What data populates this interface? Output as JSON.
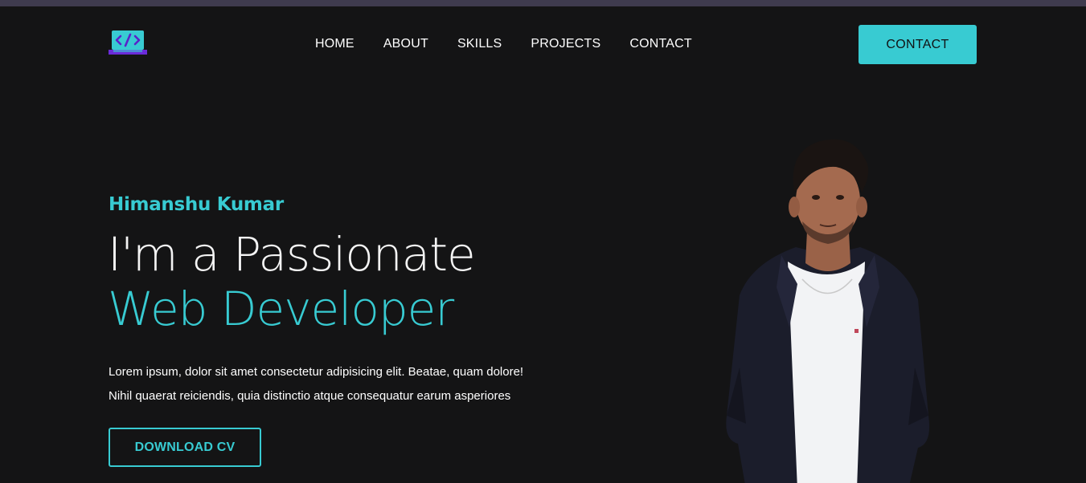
{
  "nav": {
    "logo_icon": "code-laptop-icon",
    "items": [
      "HOME",
      "ABOUT",
      "SKILLS",
      "PROJECTS",
      "CONTACT"
    ],
    "contact_button": "CONTACT"
  },
  "hero": {
    "name": "Himanshu Kumar",
    "headline_line1": "I'm a Passionate",
    "headline_line2": "Web Developer",
    "description_line1": "Lorem ipsum, dolor sit amet consectetur adipisicing elit. Beatae, quam dolore!",
    "description_line2": "Nihil quaerat reiciendis, quia distinctio atque consequatur earum asperiores",
    "download_button": "DOWNLOAD CV"
  },
  "colors": {
    "accent": "#38cbd2",
    "background": "#141415",
    "topbar": "#3f3b4e",
    "logo_purple": "#6b2bd9"
  }
}
